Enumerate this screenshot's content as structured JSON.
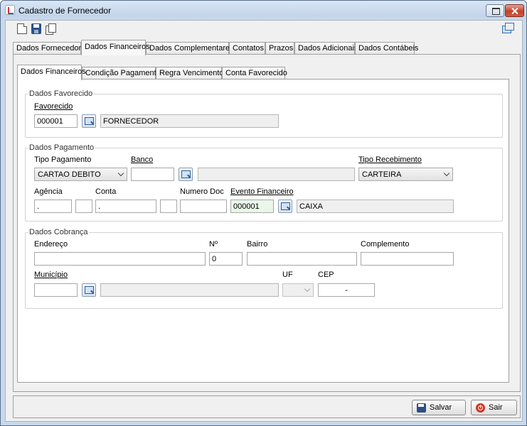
{
  "window": {
    "title": "Cadastro de Fornecedor"
  },
  "main_tabs": [
    "Dados Fornecedor",
    "Dados Financeiros",
    "Dados Complementares",
    "Contatos",
    "Prazos",
    "Dados Adicionais",
    "Dados Contábeis"
  ],
  "main_active_tab": "Dados Financeiros",
  "sub_tabs": [
    "Dados Financeiros",
    "Condição Pagamento",
    "Regra Vencimento",
    "Conta Favorecido"
  ],
  "sub_active_tab": "Dados Financeiros",
  "favorecido": {
    "group_title": "Dados Favorecido",
    "label": "Favorecido",
    "code": "000001",
    "name": "FORNECEDOR"
  },
  "pagamento": {
    "group_title": "Dados Pagamento",
    "tipo_pagamento_label": "Tipo Pagamento",
    "tipo_pagamento_value": "CARTAO DEBITO",
    "banco_label": "Banco",
    "banco_code": "",
    "banco_name": "",
    "tipo_recebimento_label": "Tipo Recebimento",
    "tipo_recebimento_value": "CARTEIRA",
    "agencia_label": "Agência",
    "agencia_value": ".",
    "agencia_dv": "",
    "conta_label": "Conta",
    "conta_value": ".",
    "conta_dv": "",
    "numero_doc_label": "Numero Doc",
    "numero_doc_value": "",
    "evento_label": "Evento Financeiro",
    "evento_code": "000001",
    "evento_name": "CAIXA"
  },
  "cobranca": {
    "group_title": "Dados Cobrança",
    "endereco_label": "Endereço",
    "endereco_value": "",
    "numero_label": "Nº",
    "numero_value": "0",
    "bairro_label": "Bairro",
    "bairro_value": "",
    "complemento_label": "Complemento",
    "complemento_value": "",
    "municipio_label": "Município",
    "municipio_code": "",
    "municipio_name": "",
    "uf_label": "UF",
    "uf_value": "",
    "cep_label": "CEP",
    "cep_value": "-"
  },
  "buttons": {
    "salvar": "Salvar",
    "sair": "Sair"
  }
}
